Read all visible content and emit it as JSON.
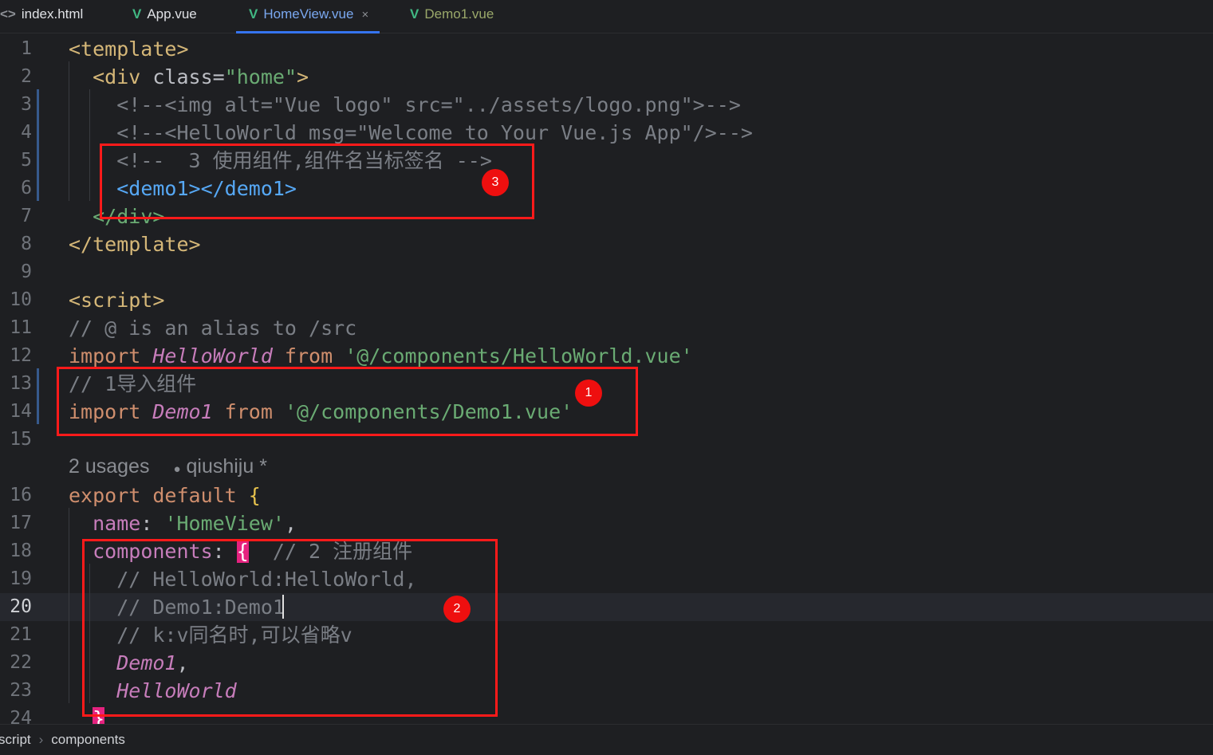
{
  "tabs": [
    {
      "label": "index.html",
      "icon": "html-file-icon",
      "glyph": "<>"
    },
    {
      "label": "App.vue",
      "icon": "vue-file-icon",
      "glyph": "V"
    },
    {
      "label": "HomeView.vue",
      "icon": "vue-file-icon",
      "glyph": "V",
      "active": true,
      "close": "×"
    },
    {
      "label": "Demo1.vue",
      "icon": "vue-file-icon",
      "glyph": "V"
    }
  ],
  "gutter": [
    "1",
    "2",
    "3",
    "4",
    "5",
    "6",
    "7",
    "8",
    "9",
    "10",
    "11",
    "12",
    "13",
    "14",
    "15",
    "16",
    "17",
    "18",
    "19",
    "20",
    "21",
    "22",
    "23",
    "24"
  ],
  "current_line": "20",
  "inlay": {
    "usages": "2 usages",
    "user_icon": "user-icon",
    "user_glyph": "●",
    "author": "qiushiju *"
  },
  "code": {
    "l1": {
      "a": "<template>"
    },
    "l2": {
      "a": "<div ",
      "b": "class=",
      "c": "\"home\"",
      "d": ">"
    },
    "l3": {
      "a": "<!--<img alt=\"Vue logo\" src=\"../assets/logo.png\">-->"
    },
    "l4": {
      "a": "<!--<HelloWorld msg=\"Welcome to Your Vue.js App\"/>-->"
    },
    "l5": {
      "a": "<!--  3 使用组件,组件名当标签名 -->"
    },
    "l6": {
      "a": "<demo1></demo1>"
    },
    "l7": {
      "a": "</div>"
    },
    "l8": {
      "a": "</template>"
    },
    "l10": {
      "a": "<script>"
    },
    "l11": {
      "a": "// @ is an alias to /src"
    },
    "l12": {
      "a": "import ",
      "b": "HelloWorld",
      "c": " from ",
      "d": "'@/components/HelloWorld.vue'"
    },
    "l13": {
      "a": "// 1导入组件"
    },
    "l14": {
      "a": "import ",
      "b": "Demo1",
      "c": " from ",
      "d": "'@/components/Demo1.vue'"
    },
    "l16": {
      "a": "export default ",
      "b": "{"
    },
    "l17": {
      "a": "name",
      "b": ": ",
      "c": "'HomeView'",
      "d": ","
    },
    "l18": {
      "a": "components",
      "b": ": ",
      "c": "{",
      "d": "  // 2 注册组件"
    },
    "l19": {
      "a": "// HelloWorld:HelloWorld,"
    },
    "l20": {
      "a": "// Demo1:Demo1"
    },
    "l21": {
      "a": "// k:v同名时,可以省略v"
    },
    "l22": {
      "a": "Demo1",
      "b": ","
    },
    "l23": {
      "a": "HelloWorld"
    },
    "l24": {
      "a": "}"
    }
  },
  "annotations": {
    "badge1": "1",
    "badge2": "2",
    "badge3": "3",
    "color": "#ff1a1a"
  },
  "statusbar": {
    "crumbs": [
      "script",
      "components"
    ],
    "separator": "›"
  },
  "colors": {
    "background": "#1e1f22",
    "accent": "#3574f0",
    "tag": "#d5b778",
    "string": "#6aab73",
    "comment": "#7a7e85",
    "keyword": "#cf8e6d",
    "component": "#c77dbb"
  }
}
